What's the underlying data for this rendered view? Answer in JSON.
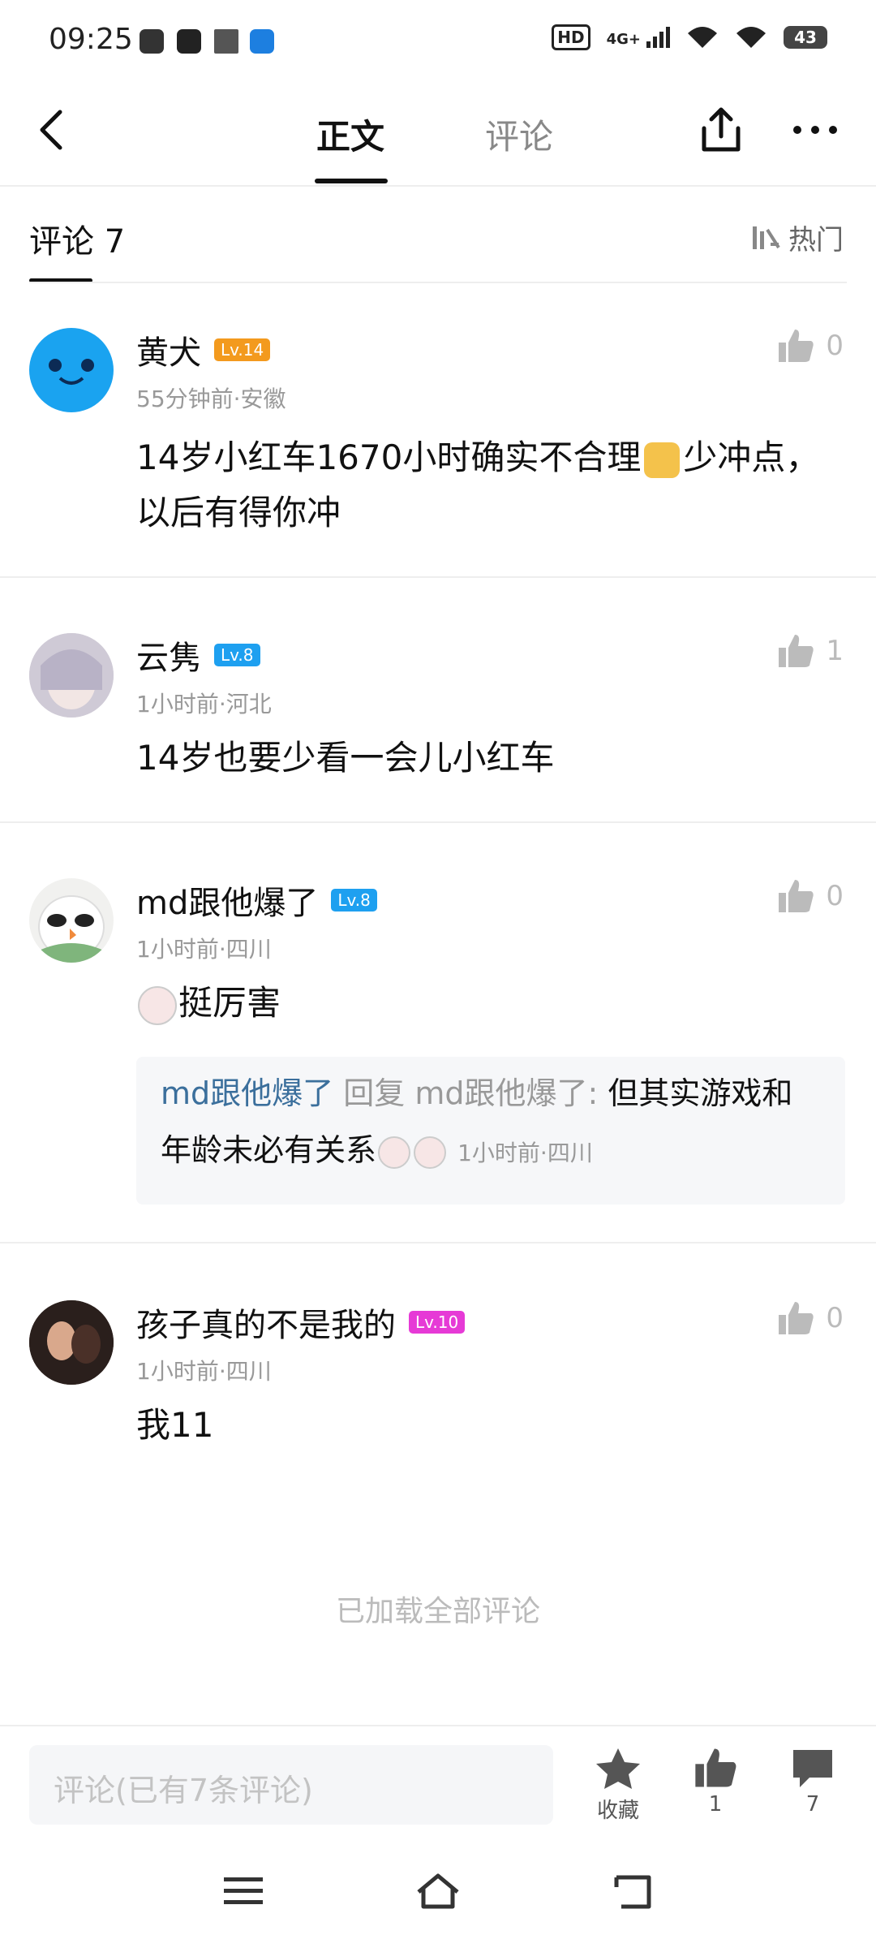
{
  "status_bar": {
    "time": "09:25",
    "hd": "HD",
    "network": "4G+",
    "battery": "43"
  },
  "nav": {
    "tab_main": "正文",
    "tab_comments": "评论"
  },
  "comments_header": {
    "title": "评论 7",
    "sort": "热门"
  },
  "comments": [
    {
      "username": "黄犬",
      "level": "Lv.14",
      "level_color": "#f39a1e",
      "meta": "55分钟前·安徽",
      "text_a": "14岁小红车1670小时确实不合理",
      "text_b": "少冲点，",
      "text_c": "以后有得你冲",
      "likes": "0"
    },
    {
      "username": "云隽",
      "level": "Lv.8",
      "level_color": "#1ea0f0",
      "meta": "1小时前·河北",
      "text": "14岁也要少看一会儿小红车",
      "likes": "1"
    },
    {
      "username": "md跟他爆了",
      "level": "Lv.8",
      "level_color": "#1ea0f0",
      "meta": "1小时前·四川",
      "text": "挺厉害",
      "likes": "0",
      "reply": {
        "user": "md跟他爆了",
        "label": "回复 md跟他爆了:",
        "text_a": "但其实游戏和",
        "text_b": "年龄未必有关系",
        "meta": "1小时前·四川"
      }
    },
    {
      "username": "孩子真的不是我的",
      "level": "Lv.10",
      "level_color": "#e63ad6",
      "meta": "1小时前·四川",
      "text": "我11",
      "likes": "0"
    }
  ],
  "footer_note": "已加载全部评论",
  "bottom_bar": {
    "input_placeholder": "评论(已有7条评论)",
    "collect_label": "收藏",
    "like_count": "1",
    "comment_count": "7"
  }
}
